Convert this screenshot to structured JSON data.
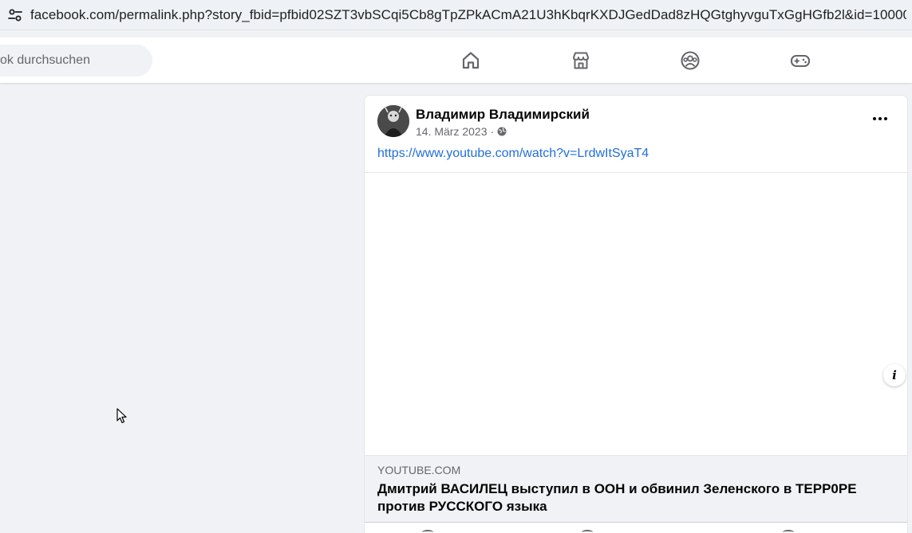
{
  "browser": {
    "url": "facebook.com/permalink.php?story_fbid=pfbid02SZT3vbSCqi5Cb8gTpZPkACmA21U3hKbqrKXDJGedDad8zHQGtghyvguTxGgHGfb2l&id=10000",
    "site_info_icon": "tune-icon"
  },
  "topnav": {
    "search_placeholder": "ok durchsuchen",
    "nav_icons": [
      "home-icon",
      "marketplace-icon",
      "groups-icon",
      "gaming-icon"
    ]
  },
  "post": {
    "author": "Владимир Владимирский",
    "date": "14. März 2023",
    "separator": "·",
    "privacy_icon": "globe-icon",
    "link_text": "https://www.youtube.com/watch?v=LrdwItSyaT4",
    "link_preview": {
      "domain": "YOUTUBE.COM",
      "title": "Дмитрий ВАСИЛЕЦ выступил в ООН и обвинил Зеленского в ТЕРР0РЕ против РУССКОГО языка"
    }
  },
  "colors": {
    "link": "#216fdb",
    "background": "#f0f2f5",
    "card": "#ffffff",
    "secondary_text": "#65676b"
  }
}
